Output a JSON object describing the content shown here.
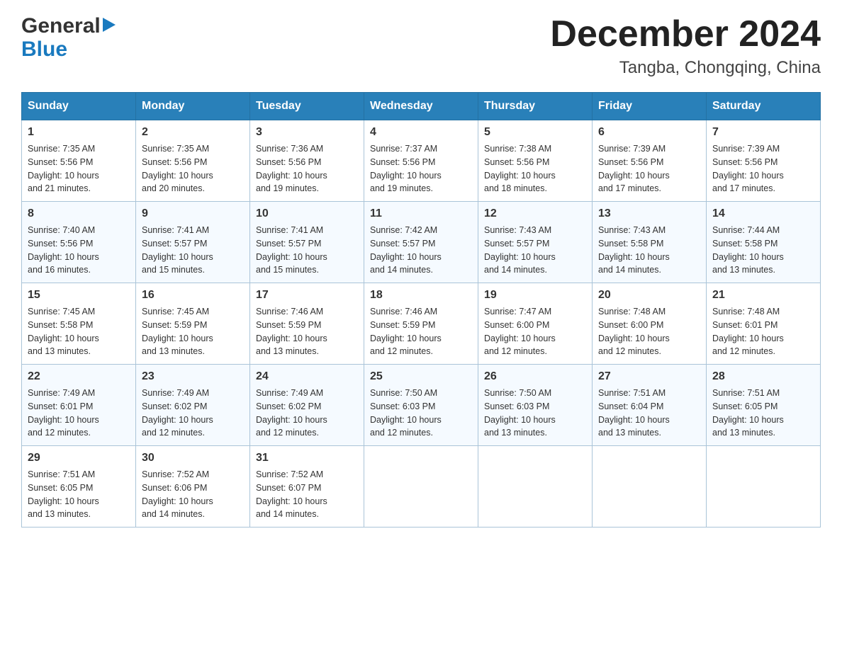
{
  "logo": {
    "line1": "General",
    "line2": "Blue"
  },
  "title": "December 2024",
  "location": "Tangba, Chongqing, China",
  "days_of_week": [
    "Sunday",
    "Monday",
    "Tuesday",
    "Wednesday",
    "Thursday",
    "Friday",
    "Saturday"
  ],
  "weeks": [
    [
      {
        "day": "1",
        "sunrise": "7:35 AM",
        "sunset": "5:56 PM",
        "daylight": "10 hours and 21 minutes."
      },
      {
        "day": "2",
        "sunrise": "7:35 AM",
        "sunset": "5:56 PM",
        "daylight": "10 hours and 20 minutes."
      },
      {
        "day": "3",
        "sunrise": "7:36 AM",
        "sunset": "5:56 PM",
        "daylight": "10 hours and 19 minutes."
      },
      {
        "day": "4",
        "sunrise": "7:37 AM",
        "sunset": "5:56 PM",
        "daylight": "10 hours and 19 minutes."
      },
      {
        "day": "5",
        "sunrise": "7:38 AM",
        "sunset": "5:56 PM",
        "daylight": "10 hours and 18 minutes."
      },
      {
        "day": "6",
        "sunrise": "7:39 AM",
        "sunset": "5:56 PM",
        "daylight": "10 hours and 17 minutes."
      },
      {
        "day": "7",
        "sunrise": "7:39 AM",
        "sunset": "5:56 PM",
        "daylight": "10 hours and 17 minutes."
      }
    ],
    [
      {
        "day": "8",
        "sunrise": "7:40 AM",
        "sunset": "5:56 PM",
        "daylight": "10 hours and 16 minutes."
      },
      {
        "day": "9",
        "sunrise": "7:41 AM",
        "sunset": "5:57 PM",
        "daylight": "10 hours and 15 minutes."
      },
      {
        "day": "10",
        "sunrise": "7:41 AM",
        "sunset": "5:57 PM",
        "daylight": "10 hours and 15 minutes."
      },
      {
        "day": "11",
        "sunrise": "7:42 AM",
        "sunset": "5:57 PM",
        "daylight": "10 hours and 14 minutes."
      },
      {
        "day": "12",
        "sunrise": "7:43 AM",
        "sunset": "5:57 PM",
        "daylight": "10 hours and 14 minutes."
      },
      {
        "day": "13",
        "sunrise": "7:43 AM",
        "sunset": "5:58 PM",
        "daylight": "10 hours and 14 minutes."
      },
      {
        "day": "14",
        "sunrise": "7:44 AM",
        "sunset": "5:58 PM",
        "daylight": "10 hours and 13 minutes."
      }
    ],
    [
      {
        "day": "15",
        "sunrise": "7:45 AM",
        "sunset": "5:58 PM",
        "daylight": "10 hours and 13 minutes."
      },
      {
        "day": "16",
        "sunrise": "7:45 AM",
        "sunset": "5:59 PM",
        "daylight": "10 hours and 13 minutes."
      },
      {
        "day": "17",
        "sunrise": "7:46 AM",
        "sunset": "5:59 PM",
        "daylight": "10 hours and 13 minutes."
      },
      {
        "day": "18",
        "sunrise": "7:46 AM",
        "sunset": "5:59 PM",
        "daylight": "10 hours and 12 minutes."
      },
      {
        "day": "19",
        "sunrise": "7:47 AM",
        "sunset": "6:00 PM",
        "daylight": "10 hours and 12 minutes."
      },
      {
        "day": "20",
        "sunrise": "7:48 AM",
        "sunset": "6:00 PM",
        "daylight": "10 hours and 12 minutes."
      },
      {
        "day": "21",
        "sunrise": "7:48 AM",
        "sunset": "6:01 PM",
        "daylight": "10 hours and 12 minutes."
      }
    ],
    [
      {
        "day": "22",
        "sunrise": "7:49 AM",
        "sunset": "6:01 PM",
        "daylight": "10 hours and 12 minutes."
      },
      {
        "day": "23",
        "sunrise": "7:49 AM",
        "sunset": "6:02 PM",
        "daylight": "10 hours and 12 minutes."
      },
      {
        "day": "24",
        "sunrise": "7:49 AM",
        "sunset": "6:02 PM",
        "daylight": "10 hours and 12 minutes."
      },
      {
        "day": "25",
        "sunrise": "7:50 AM",
        "sunset": "6:03 PM",
        "daylight": "10 hours and 12 minutes."
      },
      {
        "day": "26",
        "sunrise": "7:50 AM",
        "sunset": "6:03 PM",
        "daylight": "10 hours and 13 minutes."
      },
      {
        "day": "27",
        "sunrise": "7:51 AM",
        "sunset": "6:04 PM",
        "daylight": "10 hours and 13 minutes."
      },
      {
        "day": "28",
        "sunrise": "7:51 AM",
        "sunset": "6:05 PM",
        "daylight": "10 hours and 13 minutes."
      }
    ],
    [
      {
        "day": "29",
        "sunrise": "7:51 AM",
        "sunset": "6:05 PM",
        "daylight": "10 hours and 13 minutes."
      },
      {
        "day": "30",
        "sunrise": "7:52 AM",
        "sunset": "6:06 PM",
        "daylight": "10 hours and 14 minutes."
      },
      {
        "day": "31",
        "sunrise": "7:52 AM",
        "sunset": "6:07 PM",
        "daylight": "10 hours and 14 minutes."
      },
      null,
      null,
      null,
      null
    ]
  ],
  "labels": {
    "sunrise": "Sunrise:",
    "sunset": "Sunset:",
    "daylight": "Daylight:"
  }
}
